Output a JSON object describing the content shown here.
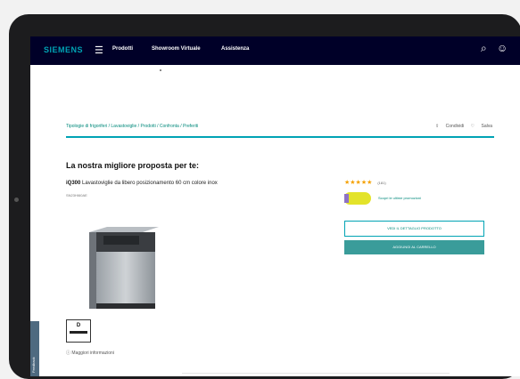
{
  "header": {
    "logo": "SIEMENS",
    "nav": [
      "Prodotti",
      "Showroom Virtuale",
      "Assistenza"
    ]
  },
  "breadcrumb": "Tipologie di frigoriferi / Lavastoviglie / Prodotti / Confronta / Preferiti",
  "tools": [
    "Condividi",
    "Salva"
  ],
  "heading": "La nostra migliore proposta per te:",
  "product": {
    "series": "iQ300",
    "title": "Lavastoviglie da libero posizionamento 60 cm colore inox",
    "model": "SN23HI60AE",
    "energy_class": "D",
    "more_info": "Maggiori informazioni"
  },
  "rating": {
    "stars": 4.5,
    "count": "(181)"
  },
  "promo": {
    "text": "Scopri le ultime promozioni"
  },
  "buttons": {
    "details": "VEDI IL DETTAGLIO PRODOTTO",
    "cart": "AGGIUNGI AL CARRELLO"
  },
  "side_tab": "Feedback",
  "colors": {
    "nav": "#000028",
    "accent": "#00a3b4",
    "button": "#3a9c9a"
  },
  "icons": [
    "menu-icon",
    "search-icon",
    "user-icon",
    "share-icon",
    "heart-icon",
    "info-icon"
  ]
}
